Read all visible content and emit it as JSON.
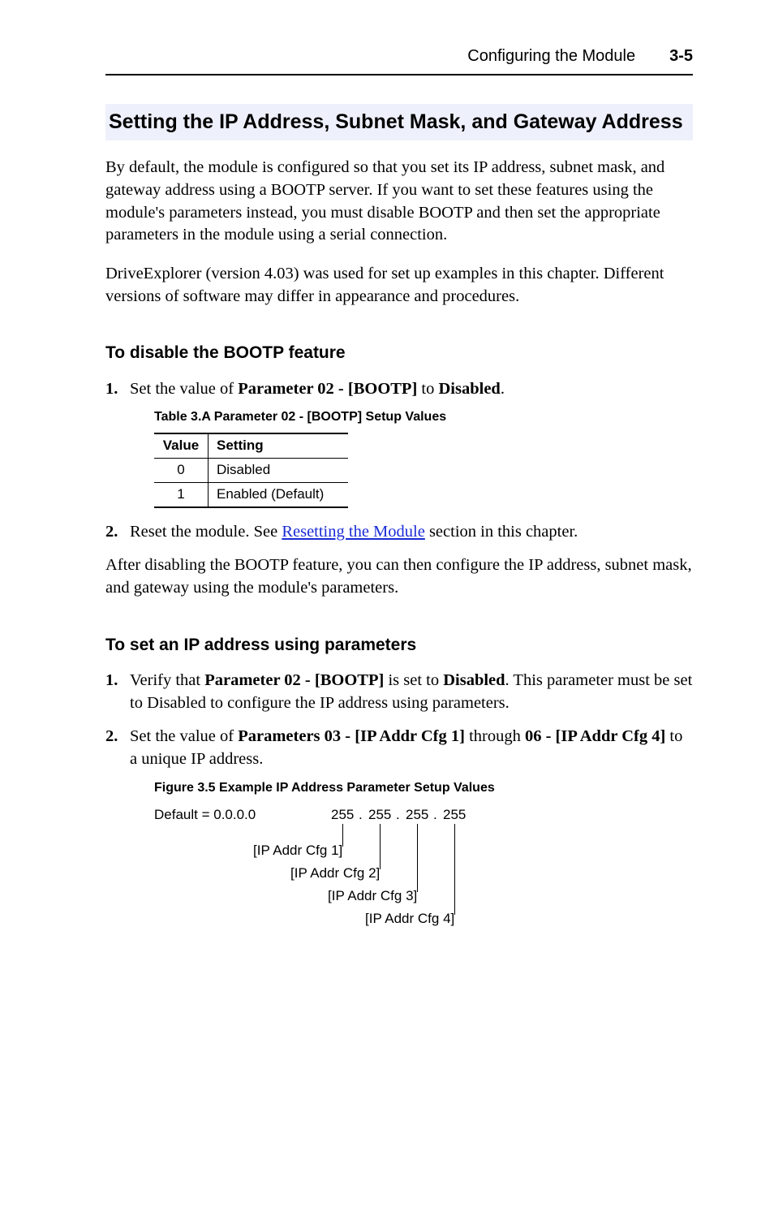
{
  "runningHeader": {
    "title": "Configuring the Module",
    "pageNumber": "3-5"
  },
  "section": {
    "heading": "Setting the IP Address, Subnet Mask, and Gateway Address",
    "para1": "By default, the module is configured so that you set its IP address, subnet mask, and gateway address using a BOOTP server. If you want to set these features using the module's parameters instead, you must disable BOOTP and then set the appropriate parameters in the module using a serial connection.",
    "para2": "DriveExplorer (version 4.03) was used for set up examples in this chapter. Different versions of software may differ in appearance and procedures."
  },
  "sub1": {
    "heading": "To disable the BOOTP feature",
    "step1": {
      "num": "1.",
      "pre": "Set the value of ",
      "bold1": "Parameter 02 - [BOOTP]",
      "mid": " to ",
      "bold2": "Disabled",
      "post": "."
    },
    "tableCaption": "Table 3.A   Parameter 02 - [BOOTP] Setup Values",
    "table": {
      "headers": {
        "col1": "Value",
        "col2": "Setting"
      },
      "rows": [
        {
          "value": "0",
          "setting": "Disabled"
        },
        {
          "value": "1",
          "setting": "Enabled (Default)"
        }
      ]
    },
    "step2": {
      "num": "2.",
      "pre": "Reset the module. See ",
      "link": "Resetting the Module",
      "post": " section in this chapter."
    },
    "afterText": "After disabling the BOOTP feature, you can then configure the IP address, subnet mask, and gateway using the module's parameters."
  },
  "sub2": {
    "heading": "To set an IP address using parameters",
    "step1": {
      "num": "1.",
      "pre": "Verify that ",
      "bold1": "Parameter 02 - [BOOTP]",
      "mid": " is set to ",
      "bold2": "Disabled",
      "post": ". This parameter must be set to Disabled to configure the IP address using parameters."
    },
    "step2": {
      "num": "2.",
      "pre": "Set the value of ",
      "bold1": "Parameters 03 - [IP Addr Cfg 1]",
      "mid": " through ",
      "bold2": "06 - [IP Addr Cfg 4]",
      "post": " to a unique IP address."
    },
    "figureCaption": "Figure 3.5   Example IP Address Parameter Setup Values",
    "diagram": {
      "defaultText": "Default = 0.0.0.0",
      "octets": [
        "255",
        "255",
        "255",
        "255"
      ],
      "dot": ".",
      "labels": [
        "[IP Addr Cfg 1]",
        "[IP Addr Cfg 2]",
        "[IP Addr Cfg 3]",
        "[IP Addr Cfg 4]"
      ]
    }
  }
}
